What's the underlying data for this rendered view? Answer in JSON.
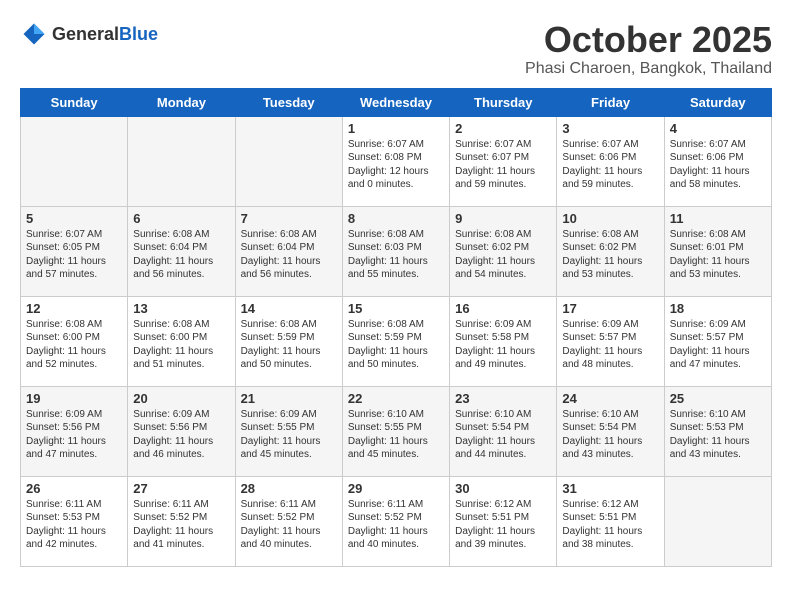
{
  "header": {
    "logo_general": "General",
    "logo_blue": "Blue",
    "month": "October 2025",
    "location": "Phasi Charoen, Bangkok, Thailand"
  },
  "weekdays": [
    "Sunday",
    "Monday",
    "Tuesday",
    "Wednesday",
    "Thursday",
    "Friday",
    "Saturday"
  ],
  "weeks": [
    [
      {
        "day": "",
        "sunrise": "",
        "sunset": "",
        "daylight": "",
        "empty": true
      },
      {
        "day": "",
        "sunrise": "",
        "sunset": "",
        "daylight": "",
        "empty": true
      },
      {
        "day": "",
        "sunrise": "",
        "sunset": "",
        "daylight": "",
        "empty": true
      },
      {
        "day": "1",
        "sunrise": "Sunrise: 6:07 AM",
        "sunset": "Sunset: 6:08 PM",
        "daylight": "Daylight: 12 hours and 0 minutes."
      },
      {
        "day": "2",
        "sunrise": "Sunrise: 6:07 AM",
        "sunset": "Sunset: 6:07 PM",
        "daylight": "Daylight: 11 hours and 59 minutes."
      },
      {
        "day": "3",
        "sunrise": "Sunrise: 6:07 AM",
        "sunset": "Sunset: 6:06 PM",
        "daylight": "Daylight: 11 hours and 59 minutes."
      },
      {
        "day": "4",
        "sunrise": "Sunrise: 6:07 AM",
        "sunset": "Sunset: 6:06 PM",
        "daylight": "Daylight: 11 hours and 58 minutes."
      }
    ],
    [
      {
        "day": "5",
        "sunrise": "Sunrise: 6:07 AM",
        "sunset": "Sunset: 6:05 PM",
        "daylight": "Daylight: 11 hours and 57 minutes."
      },
      {
        "day": "6",
        "sunrise": "Sunrise: 6:08 AM",
        "sunset": "Sunset: 6:04 PM",
        "daylight": "Daylight: 11 hours and 56 minutes."
      },
      {
        "day": "7",
        "sunrise": "Sunrise: 6:08 AM",
        "sunset": "Sunset: 6:04 PM",
        "daylight": "Daylight: 11 hours and 56 minutes."
      },
      {
        "day": "8",
        "sunrise": "Sunrise: 6:08 AM",
        "sunset": "Sunset: 6:03 PM",
        "daylight": "Daylight: 11 hours and 55 minutes."
      },
      {
        "day": "9",
        "sunrise": "Sunrise: 6:08 AM",
        "sunset": "Sunset: 6:02 PM",
        "daylight": "Daylight: 11 hours and 54 minutes."
      },
      {
        "day": "10",
        "sunrise": "Sunrise: 6:08 AM",
        "sunset": "Sunset: 6:02 PM",
        "daylight": "Daylight: 11 hours and 53 minutes."
      },
      {
        "day": "11",
        "sunrise": "Sunrise: 6:08 AM",
        "sunset": "Sunset: 6:01 PM",
        "daylight": "Daylight: 11 hours and 53 minutes."
      }
    ],
    [
      {
        "day": "12",
        "sunrise": "Sunrise: 6:08 AM",
        "sunset": "Sunset: 6:00 PM",
        "daylight": "Daylight: 11 hours and 52 minutes."
      },
      {
        "day": "13",
        "sunrise": "Sunrise: 6:08 AM",
        "sunset": "Sunset: 6:00 PM",
        "daylight": "Daylight: 11 hours and 51 minutes."
      },
      {
        "day": "14",
        "sunrise": "Sunrise: 6:08 AM",
        "sunset": "Sunset: 5:59 PM",
        "daylight": "Daylight: 11 hours and 50 minutes."
      },
      {
        "day": "15",
        "sunrise": "Sunrise: 6:08 AM",
        "sunset": "Sunset: 5:59 PM",
        "daylight": "Daylight: 11 hours and 50 minutes."
      },
      {
        "day": "16",
        "sunrise": "Sunrise: 6:09 AM",
        "sunset": "Sunset: 5:58 PM",
        "daylight": "Daylight: 11 hours and 49 minutes."
      },
      {
        "day": "17",
        "sunrise": "Sunrise: 6:09 AM",
        "sunset": "Sunset: 5:57 PM",
        "daylight": "Daylight: 11 hours and 48 minutes."
      },
      {
        "day": "18",
        "sunrise": "Sunrise: 6:09 AM",
        "sunset": "Sunset: 5:57 PM",
        "daylight": "Daylight: 11 hours and 47 minutes."
      }
    ],
    [
      {
        "day": "19",
        "sunrise": "Sunrise: 6:09 AM",
        "sunset": "Sunset: 5:56 PM",
        "daylight": "Daylight: 11 hours and 47 minutes."
      },
      {
        "day": "20",
        "sunrise": "Sunrise: 6:09 AM",
        "sunset": "Sunset: 5:56 PM",
        "daylight": "Daylight: 11 hours and 46 minutes."
      },
      {
        "day": "21",
        "sunrise": "Sunrise: 6:09 AM",
        "sunset": "Sunset: 5:55 PM",
        "daylight": "Daylight: 11 hours and 45 minutes."
      },
      {
        "day": "22",
        "sunrise": "Sunrise: 6:10 AM",
        "sunset": "Sunset: 5:55 PM",
        "daylight": "Daylight: 11 hours and 45 minutes."
      },
      {
        "day": "23",
        "sunrise": "Sunrise: 6:10 AM",
        "sunset": "Sunset: 5:54 PM",
        "daylight": "Daylight: 11 hours and 44 minutes."
      },
      {
        "day": "24",
        "sunrise": "Sunrise: 6:10 AM",
        "sunset": "Sunset: 5:54 PM",
        "daylight": "Daylight: 11 hours and 43 minutes."
      },
      {
        "day": "25",
        "sunrise": "Sunrise: 6:10 AM",
        "sunset": "Sunset: 5:53 PM",
        "daylight": "Daylight: 11 hours and 43 minutes."
      }
    ],
    [
      {
        "day": "26",
        "sunrise": "Sunrise: 6:11 AM",
        "sunset": "Sunset: 5:53 PM",
        "daylight": "Daylight: 11 hours and 42 minutes."
      },
      {
        "day": "27",
        "sunrise": "Sunrise: 6:11 AM",
        "sunset": "Sunset: 5:52 PM",
        "daylight": "Daylight: 11 hours and 41 minutes."
      },
      {
        "day": "28",
        "sunrise": "Sunrise: 6:11 AM",
        "sunset": "Sunset: 5:52 PM",
        "daylight": "Daylight: 11 hours and 40 minutes."
      },
      {
        "day": "29",
        "sunrise": "Sunrise: 6:11 AM",
        "sunset": "Sunset: 5:52 PM",
        "daylight": "Daylight: 11 hours and 40 minutes."
      },
      {
        "day": "30",
        "sunrise": "Sunrise: 6:12 AM",
        "sunset": "Sunset: 5:51 PM",
        "daylight": "Daylight: 11 hours and 39 minutes."
      },
      {
        "day": "31",
        "sunrise": "Sunrise: 6:12 AM",
        "sunset": "Sunset: 5:51 PM",
        "daylight": "Daylight: 11 hours and 38 minutes."
      },
      {
        "day": "",
        "sunrise": "",
        "sunset": "",
        "daylight": "",
        "empty": true
      }
    ]
  ]
}
